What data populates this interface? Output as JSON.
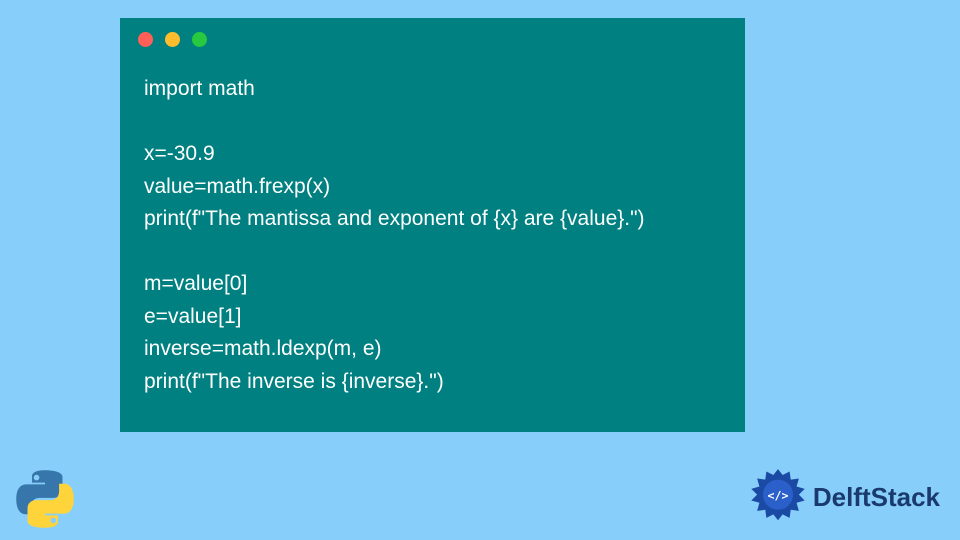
{
  "code": {
    "lines": [
      "import math",
      "",
      "x=-30.9",
      "value=math.frexp(x)",
      "print(f\"The mantissa and exponent of {x} are {value}.\")",
      "",
      "m=value[0]",
      "e=value[1]",
      "inverse=math.ldexp(m, e)",
      "print(f\"The inverse is {inverse}.\")"
    ]
  },
  "branding": {
    "name": "DelftStack"
  },
  "colors": {
    "background": "#87cefa",
    "window": "#008080",
    "dot_red": "#ff5f56",
    "dot_yellow": "#ffbd2e",
    "dot_green": "#27c93f",
    "brand_text": "#1a3a6e"
  }
}
